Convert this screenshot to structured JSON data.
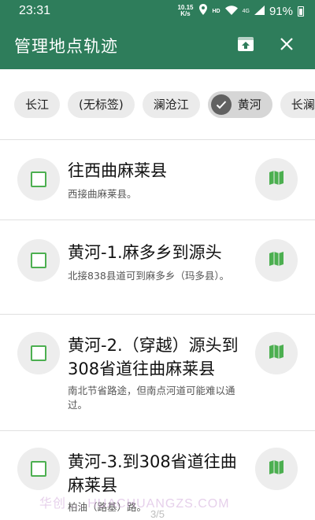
{
  "status_bar": {
    "time": "23:31",
    "net_speed_value": "10.15",
    "net_speed_unit": "K/s",
    "hd_label": "HD",
    "signal_label": "4G",
    "battery": "91%"
  },
  "app_bar": {
    "title": "管理地点轨迹",
    "colors": {
      "bar": "#2e7d5b",
      "accent": "#4caf50"
    },
    "actions": [
      {
        "icon": "upload-box-icon"
      },
      {
        "icon": "close-icon"
      }
    ]
  },
  "tags": {
    "chips": [
      {
        "label": "长江",
        "selected": false
      },
      {
        "label": "(无标签)",
        "selected": false
      },
      {
        "label": "澜沧江",
        "selected": false
      },
      {
        "label": "黄河",
        "selected": true
      },
      {
        "label": "长澜",
        "selected": false
      }
    ]
  },
  "tracks": {
    "items": [
      {
        "title": "往西曲麻莱县",
        "subtitle": "西接曲麻莱县。",
        "checked": false,
        "icon": "map-icon"
      },
      {
        "title": "黄河-1.麻多乡到源头",
        "subtitle": "北接838县道可到麻多乡（玛多县）。",
        "checked": false,
        "icon": "map-icon"
      },
      {
        "title": "黄河-2.（穿越）源头到308省道往曲麻莱县",
        "subtitle": "南北节省路途，但南点河道可能难以通过。",
        "checked": false,
        "icon": "map-icon"
      },
      {
        "title": "黄河-3.到308省道往曲麻莱县",
        "subtitle": "柏油（路基）路。",
        "checked": false,
        "icon": "map-icon"
      }
    ]
  },
  "watermark": "华创 ... HUACHUANGZS.COM",
  "page_indicator": "3/5"
}
